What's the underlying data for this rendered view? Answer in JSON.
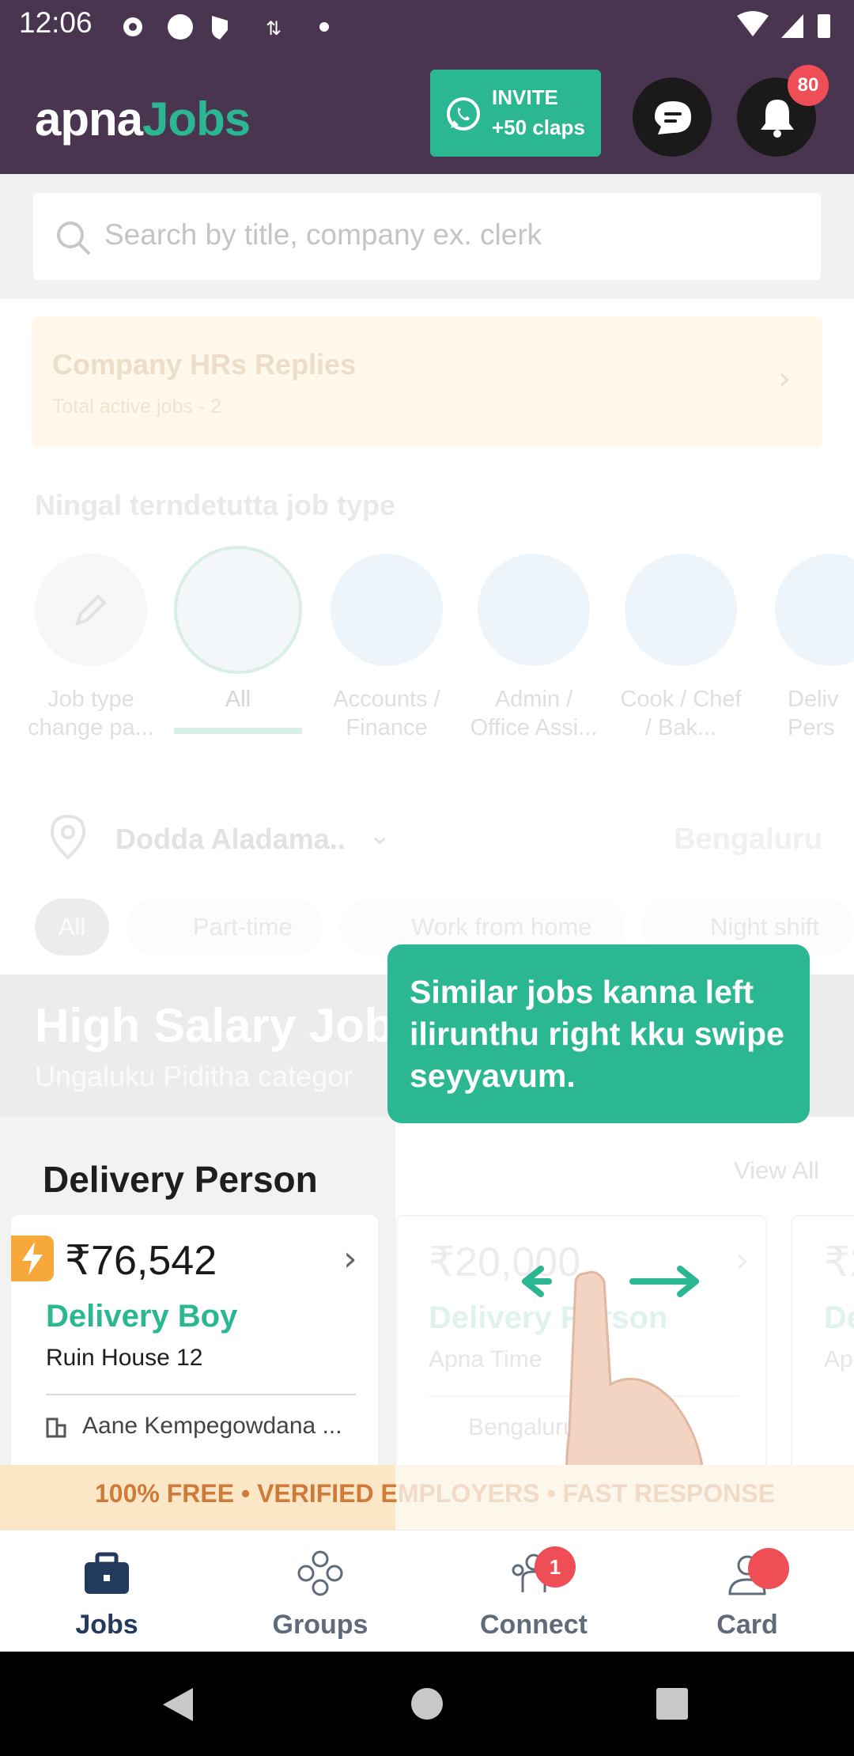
{
  "status_bar": {
    "time": "12:06"
  },
  "header": {
    "logo_part1": "apna",
    "logo_part2": "Jobs",
    "invite_line1": "INVITE",
    "invite_line2": "+50 claps",
    "notification_count": "80",
    "accent_color": "#2bb792",
    "header_color": "#4a3550"
  },
  "search": {
    "placeholder": "Search by title, company ex. clerk"
  },
  "hr_card": {
    "title": "Company HRs Replies",
    "subtitle": "Total active jobs - 2"
  },
  "job_types": {
    "title": "Ningal terndetutta job type",
    "items": [
      {
        "label": "Job type change pa..."
      },
      {
        "label": "All"
      },
      {
        "label": "Accounts / Finance"
      },
      {
        "label": "Admin / Office Assi..."
      },
      {
        "label": "Cook / Chef / Bak..."
      },
      {
        "label": "Deliv Pers"
      }
    ]
  },
  "location": {
    "area": "Dodda Aladama..",
    "city": "Bengaluru"
  },
  "filters": [
    "All",
    "Part-time",
    "Work from home",
    "Night shift"
  ],
  "high_salary": {
    "title": "High Salary Jobs",
    "subtitle": "Ungaluku Piditha categor"
  },
  "tooltip": {
    "text": "Similar jobs kanna left ilirunthu right kku swipe seyyavum."
  },
  "delivery": {
    "section_title": "Delivery Person",
    "view_all": "View All",
    "cards": [
      {
        "salary": "₹76,542",
        "title": "Delivery Boy",
        "company": "Ruin House 12",
        "location": "Aane Kempegowdana ..."
      },
      {
        "salary": "₹20,000",
        "title": "Delivery Person",
        "company": "Apna Time",
        "location": "Bengaluru"
      },
      {
        "salary": "₹2",
        "title": "De",
        "company": "Ap"
      }
    ]
  },
  "banner": {
    "text_visible": "100% FREE • VERIFIED E",
    "text_faded": "MPLOYERS • FAST RESPONSE"
  },
  "bottom_nav": {
    "items": [
      {
        "label": "Jobs",
        "icon": "briefcase-icon"
      },
      {
        "label": "Groups",
        "icon": "groups-icon"
      },
      {
        "label": "Connect",
        "icon": "connect-icon",
        "badge": "1"
      },
      {
        "label": "Card",
        "icon": "profile-card-icon"
      }
    ]
  }
}
